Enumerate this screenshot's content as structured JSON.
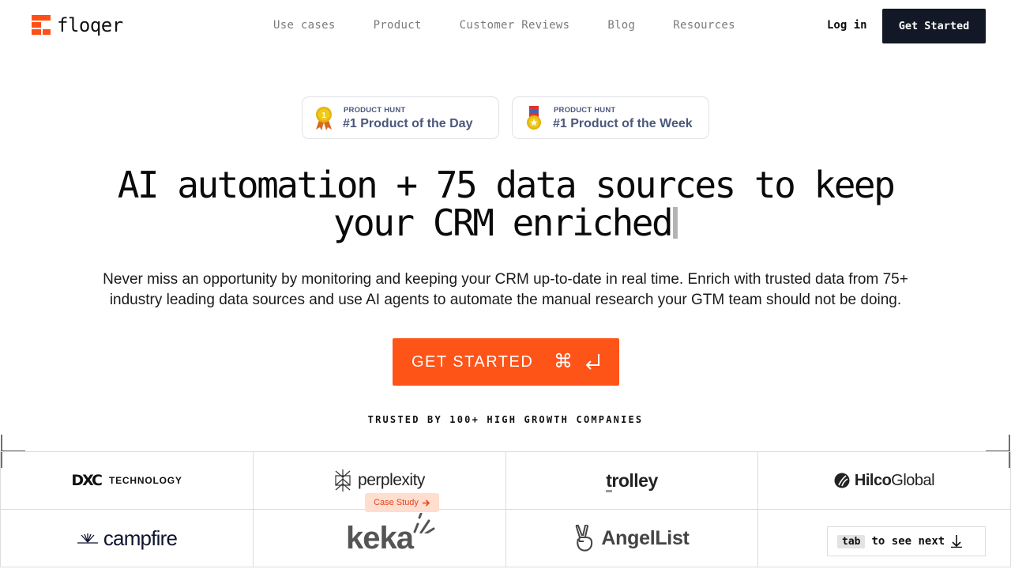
{
  "brand": {
    "name": "floqer",
    "accent": "#ff4f17"
  },
  "nav": {
    "items": [
      {
        "label": "Use cases"
      },
      {
        "label": "Product"
      },
      {
        "label": "Customer Reviews"
      },
      {
        "label": "Blog"
      },
      {
        "label": "Resources"
      }
    ],
    "login_label": "Log in",
    "cta_label": "Get Started"
  },
  "badges": [
    {
      "kicker": "PRODUCT HUNT",
      "title": "#1 Product of the Day",
      "icon": "medal-gold-icon"
    },
    {
      "kicker": "PRODUCT HUNT",
      "title": "#1 Product of the Week",
      "icon": "medal-ribbon-icon"
    }
  ],
  "hero": {
    "headline_line1": "AI automation + 75 data sources to keep",
    "headline_line2": "your CRM enriched",
    "subtitle_line1": "Never miss an opportunity by monitoring and keeping your CRM up-to-date in real time. Enrich with trusted data from 75+",
    "subtitle_line2": "industry leading data sources and use AI agents to automate the manual research your GTM team should not be doing.",
    "cta_label": "GET STARTED",
    "cta_shortcut": "⌘"
  },
  "trusted": {
    "label": "TRUSTED BY 100+ HIGH GROWTH COMPANIES"
  },
  "logos": {
    "dxc_mark": "DXC",
    "dxc_text": "TECHNOLOGY",
    "perplexity": "perplexity",
    "trolley": "trolley",
    "hilco_bold": "Hilco",
    "hilco_light": "Global",
    "campfire": "campfire",
    "keka": "keka",
    "angellist": "AngelList"
  },
  "case_study": {
    "label": "Case Study"
  },
  "tab_hint": {
    "key": "tab",
    "text": "to see next"
  }
}
